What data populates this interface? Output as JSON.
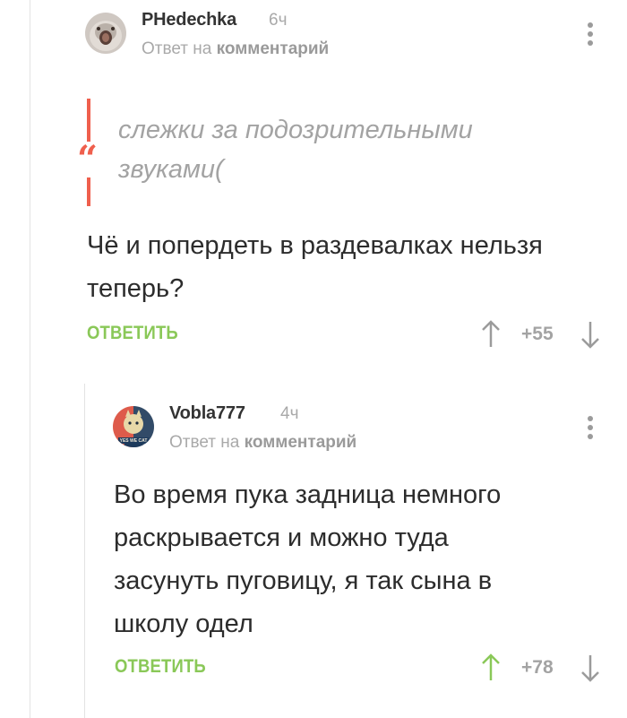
{
  "comment1": {
    "author": "PHedechka",
    "time": "6ч",
    "reply_prefix": "Ответ на",
    "reply_target": "комментарий",
    "quote": "слежки за подозрительными звуками(",
    "text": "Чё и попердеть в раздевалках нельзя теперь?",
    "reply_label": "ОТВЕТИТЬ",
    "score": "+55"
  },
  "comment2": {
    "author": "Vobla777",
    "time": "4ч",
    "reply_prefix": "Ответ на",
    "reply_target": "комментарий",
    "avatar_caption": "YES WE CAT",
    "text": "Во время пука задница немного раскрывается и можно туда засунуть пуговицу, я так сына в школу одел",
    "reply_label": "ОТВЕТИТЬ",
    "score": "+78",
    "upvoted": true
  },
  "colors": {
    "accent_green": "#8ac858",
    "quote_red": "#ef5f4d",
    "muted": "#a9a9a9",
    "text": "#2c2c2c"
  },
  "icons": [
    "more-vertical-icon",
    "arrow-up-icon",
    "arrow-down-icon",
    "quote-icon"
  ]
}
